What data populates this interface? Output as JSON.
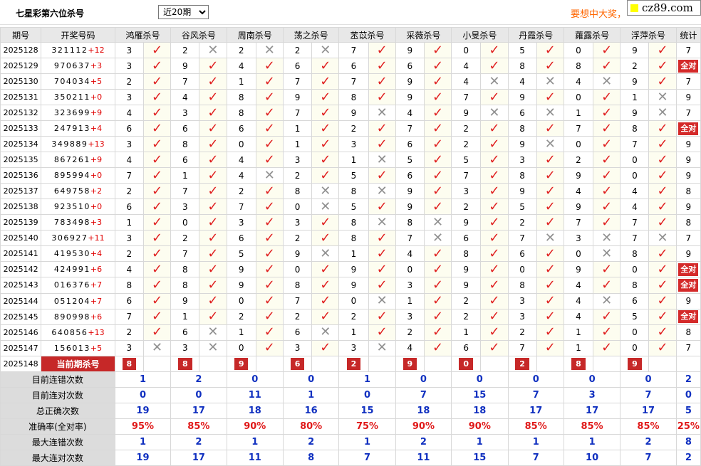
{
  "header": {
    "title": "七星彩第六位杀号",
    "period_selected": "近20期",
    "period_options": [
      "近20期"
    ],
    "ad_text": "要想中大奖，",
    "logo_text": "cz89.com"
  },
  "table": {
    "col_issue": "期号",
    "col_draw": "开奖号码",
    "col_stat": "统计",
    "experts": [
      "鸿雁杀号",
      "谷风杀号",
      "周南杀号",
      "荡之杀号",
      "苤苡杀号",
      "采薇杀号",
      "小旻杀号",
      "丹霞杀号",
      "蕹露杀号",
      "浮萍杀号"
    ],
    "all_correct_label": "全对",
    "current_label": "当前期杀号",
    "rows": [
      {
        "issue": "2025128",
        "digits": "321112",
        "add": "+12",
        "kills": [
          3,
          2,
          2,
          2,
          7,
          9,
          0,
          5,
          0,
          9
        ],
        "ok": [
          1,
          0,
          0,
          0,
          1,
          1,
          1,
          1,
          1,
          1
        ],
        "stat": "7"
      },
      {
        "issue": "2025129",
        "digits": "970637",
        "add": "+3",
        "kills": [
          3,
          9,
          4,
          6,
          6,
          6,
          4,
          8,
          8,
          2
        ],
        "ok": [
          1,
          1,
          1,
          1,
          1,
          1,
          1,
          1,
          1,
          1
        ],
        "stat": "全对"
      },
      {
        "issue": "2025130",
        "digits": "704034",
        "add": "+5",
        "kills": [
          2,
          7,
          1,
          7,
          7,
          9,
          4,
          4,
          4,
          9
        ],
        "ok": [
          1,
          1,
          1,
          1,
          1,
          1,
          0,
          0,
          0,
          1
        ],
        "stat": "7"
      },
      {
        "issue": "2025131",
        "digits": "350211",
        "add": "+0",
        "kills": [
          3,
          4,
          8,
          9,
          8,
          9,
          7,
          9,
          0,
          1
        ],
        "ok": [
          1,
          1,
          1,
          1,
          1,
          1,
          1,
          1,
          1,
          0
        ],
        "stat": "9"
      },
      {
        "issue": "2025132",
        "digits": "323699",
        "add": "+9",
        "kills": [
          4,
          3,
          8,
          7,
          9,
          4,
          9,
          6,
          1,
          9
        ],
        "ok": [
          1,
          1,
          1,
          1,
          0,
          1,
          0,
          0,
          1,
          0
        ],
        "stat": "7"
      },
      {
        "issue": "2025133",
        "digits": "247913",
        "add": "+4",
        "kills": [
          6,
          6,
          6,
          1,
          2,
          7,
          2,
          8,
          7,
          8
        ],
        "ok": [
          1,
          1,
          1,
          1,
          1,
          1,
          1,
          1,
          1,
          1
        ],
        "stat": "全对"
      },
      {
        "issue": "2025134",
        "digits": "349889",
        "add": "+13",
        "kills": [
          3,
          8,
          0,
          1,
          3,
          6,
          2,
          9,
          0,
          7
        ],
        "ok": [
          1,
          1,
          1,
          1,
          1,
          1,
          1,
          0,
          1,
          1
        ],
        "stat": "9"
      },
      {
        "issue": "2025135",
        "digits": "867261",
        "add": "+9",
        "kills": [
          4,
          6,
          4,
          3,
          1,
          5,
          5,
          3,
          2,
          0
        ],
        "ok": [
          1,
          1,
          1,
          1,
          0,
          1,
          1,
          1,
          1,
          1
        ],
        "stat": "9"
      },
      {
        "issue": "2025136",
        "digits": "895994",
        "add": "+0",
        "kills": [
          7,
          1,
          4,
          2,
          5,
          6,
          7,
          8,
          9,
          0
        ],
        "ok": [
          1,
          1,
          0,
          1,
          1,
          1,
          1,
          1,
          1,
          1
        ],
        "stat": "9"
      },
      {
        "issue": "2025137",
        "digits": "649758",
        "add": "+2",
        "kills": [
          2,
          7,
          2,
          8,
          8,
          9,
          3,
          9,
          4,
          4
        ],
        "ok": [
          1,
          1,
          1,
          0,
          0,
          1,
          1,
          1,
          1,
          1
        ],
        "stat": "8"
      },
      {
        "issue": "2025138",
        "digits": "923510",
        "add": "+0",
        "kills": [
          6,
          3,
          7,
          0,
          5,
          9,
          2,
          5,
          9,
          4
        ],
        "ok": [
          1,
          1,
          1,
          0,
          1,
          1,
          1,
          1,
          1,
          1
        ],
        "stat": "9"
      },
      {
        "issue": "2025139",
        "digits": "783498",
        "add": "+3",
        "kills": [
          1,
          0,
          3,
          3,
          8,
          8,
          9,
          2,
          7,
          7
        ],
        "ok": [
          1,
          1,
          1,
          1,
          0,
          0,
          1,
          1,
          1,
          1
        ],
        "stat": "8"
      },
      {
        "issue": "2025140",
        "digits": "306927",
        "add": "+11",
        "kills": [
          3,
          2,
          6,
          2,
          8,
          7,
          6,
          7,
          3,
          7
        ],
        "ok": [
          1,
          1,
          1,
          1,
          1,
          0,
          1,
          0,
          0,
          0
        ],
        "stat": "7"
      },
      {
        "issue": "2025141",
        "digits": "419530",
        "add": "+4",
        "kills": [
          2,
          7,
          5,
          9,
          1,
          4,
          8,
          6,
          0,
          8
        ],
        "ok": [
          1,
          1,
          1,
          0,
          1,
          1,
          1,
          1,
          0,
          1
        ],
        "stat": "9"
      },
      {
        "issue": "2025142",
        "digits": "424991",
        "add": "+6",
        "kills": [
          4,
          8,
          9,
          0,
          9,
          0,
          9,
          0,
          9,
          0
        ],
        "ok": [
          1,
          1,
          1,
          1,
          1,
          1,
          1,
          1,
          1,
          1
        ],
        "stat": "全对"
      },
      {
        "issue": "2025143",
        "digits": "016376",
        "add": "+7",
        "kills": [
          8,
          8,
          9,
          8,
          9,
          3,
          9,
          8,
          4,
          8
        ],
        "ok": [
          1,
          1,
          1,
          1,
          1,
          1,
          1,
          1,
          1,
          1
        ],
        "stat": "全对"
      },
      {
        "issue": "2025144",
        "digits": "051204",
        "add": "+7",
        "kills": [
          6,
          9,
          0,
          7,
          0,
          1,
          2,
          3,
          4,
          6
        ],
        "ok": [
          1,
          1,
          1,
          1,
          0,
          1,
          1,
          1,
          0,
          1
        ],
        "stat": "9"
      },
      {
        "issue": "2025145",
        "digits": "890998",
        "add": "+6",
        "kills": [
          7,
          1,
          2,
          2,
          2,
          3,
          2,
          3,
          4,
          5
        ],
        "ok": [
          1,
          1,
          1,
          1,
          1,
          1,
          1,
          1,
          1,
          1
        ],
        "stat": "全对"
      },
      {
        "issue": "2025146",
        "digits": "640856",
        "add": "+13",
        "kills": [
          2,
          6,
          1,
          6,
          1,
          2,
          1,
          2,
          1,
          0
        ],
        "ok": [
          1,
          0,
          1,
          0,
          1,
          1,
          1,
          1,
          1,
          1
        ],
        "stat": "8"
      },
      {
        "issue": "2025147",
        "digits": "156013",
        "add": "+5",
        "kills": [
          3,
          3,
          0,
          3,
          3,
          4,
          6,
          7,
          1,
          0
        ],
        "ok": [
          0,
          0,
          1,
          1,
          0,
          1,
          1,
          1,
          1,
          1
        ],
        "stat": "7"
      }
    ],
    "current": {
      "issue": "2025148",
      "kills": [
        8,
        8,
        9,
        6,
        2,
        9,
        0,
        2,
        8,
        9
      ]
    },
    "stats": [
      {
        "label": "目前连错次数",
        "vals": [
          "1",
          "2",
          "0",
          "0",
          "1",
          "0",
          "0",
          "0",
          "0",
          "0"
        ],
        "total": "2",
        "red": false
      },
      {
        "label": "目前连对次数",
        "vals": [
          "0",
          "0",
          "11",
          "1",
          "0",
          "7",
          "15",
          "7",
          "3",
          "7"
        ],
        "total": "0",
        "red": false
      },
      {
        "label": "总正确次数",
        "vals": [
          "19",
          "17",
          "18",
          "16",
          "15",
          "18",
          "18",
          "17",
          "17",
          "17"
        ],
        "total": "5",
        "red": false
      },
      {
        "label": "准确率(全对率)",
        "vals": [
          "95%",
          "85%",
          "90%",
          "80%",
          "75%",
          "90%",
          "90%",
          "85%",
          "85%",
          "85%"
        ],
        "total": "25%",
        "red": true
      },
      {
        "label": "最大连错次数",
        "vals": [
          "1",
          "2",
          "1",
          "2",
          "1",
          "2",
          "1",
          "1",
          "1",
          "2"
        ],
        "total": "8",
        "red": false
      },
      {
        "label": "最大连对次数",
        "vals": [
          "19",
          "17",
          "11",
          "8",
          "7",
          "11",
          "15",
          "7",
          "10",
          "7"
        ],
        "total": "2",
        "red": false
      }
    ]
  },
  "colors": {
    "check": "#e02020",
    "cross": "#909090",
    "badge": "#c62828",
    "stat_blue": "#1030c0",
    "stat_red": "#e01818",
    "ad": "#ff6600"
  },
  "icons": {
    "correct": "check-icon",
    "wrong": "cross-icon"
  }
}
